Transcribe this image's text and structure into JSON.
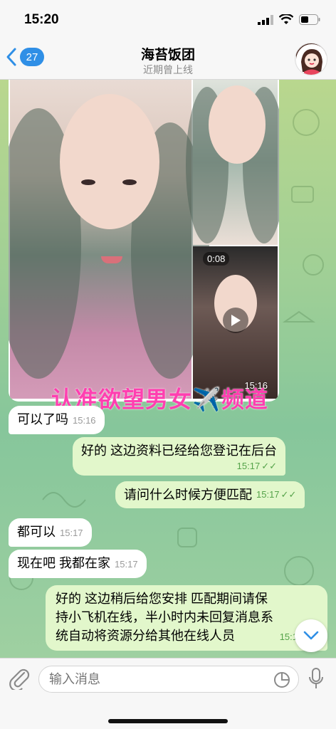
{
  "status_bar": {
    "time": "15:20"
  },
  "header": {
    "back_count": "27",
    "title": "海苔饭团",
    "subtitle": "近期曾上线"
  },
  "media": {
    "video_duration": "0:08",
    "time": "15:16",
    "watermark": "认准欲望男女✈️频道"
  },
  "messages": [
    {
      "dir": "in",
      "text": "可以了吗",
      "time": "15:16"
    },
    {
      "dir": "out",
      "text": "好的 这边资料已经给您登记在后台",
      "time": "15:17"
    },
    {
      "dir": "out",
      "text": "请问什么时候方便匹配",
      "time": "15:17"
    },
    {
      "dir": "in",
      "text": "都可以",
      "time": "15:17"
    },
    {
      "dir": "in",
      "text": "现在吧 我都在家",
      "time": "15:17"
    },
    {
      "dir": "out",
      "text_lines": [
        "好的 这边稍后给您安排 匹配期间请保",
        "持小飞机在线，半小时内未回复消息系",
        "统自动将资源分给其他在线人员"
      ],
      "time": "15:1"
    }
  ],
  "input": {
    "placeholder": "输入消息"
  },
  "colors": {
    "accent": "#2f8fe6",
    "out_bubble": "#e2f7cb",
    "watermark": "#ff3fb0"
  }
}
